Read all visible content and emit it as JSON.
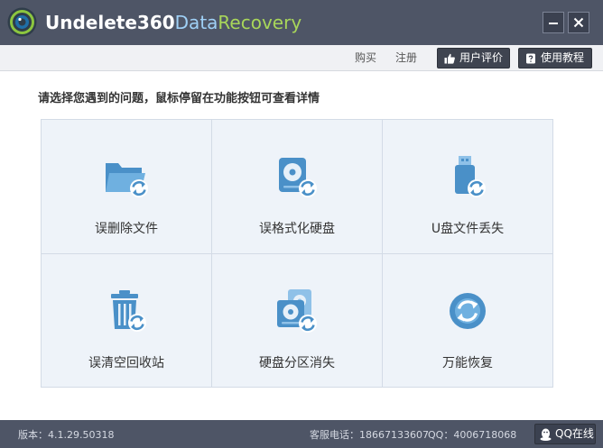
{
  "app": {
    "name_part1": "Undelete360",
    "name_part2": "Data",
    "name_part3": "Recovery"
  },
  "window_controls": {
    "minimize": "—",
    "close": "✕"
  },
  "subbar": {
    "buy": "购买",
    "register": "注册",
    "review_button": "用户评价",
    "guide_button": "使用教程"
  },
  "main": {
    "prompt": "请选择您遇到的问题，鼠标停留在功能按钮可查看详情",
    "tiles": [
      {
        "label": "误删除文件",
        "icon": "folder-recovery-icon"
      },
      {
        "label": "误格式化硬盘",
        "icon": "disk-format-icon"
      },
      {
        "label": "U盘文件丢失",
        "icon": "usb-drive-icon"
      },
      {
        "label": "误清空回收站",
        "icon": "recycle-bin-icon"
      },
      {
        "label": "硬盘分区消失",
        "icon": "disk-partition-icon"
      },
      {
        "label": "万能恢复",
        "icon": "universal-recovery-icon"
      }
    ]
  },
  "statusbar": {
    "version": "版本：4.1.29.50318",
    "service_phone": "客服电话：18667133607",
    "qq": "QQ：4006718068",
    "qq_online": "QQ在线"
  },
  "colors": {
    "titlebar": "#4e5566",
    "accent_blue": "#4a90c8",
    "tile_bg": "#eef3f9",
    "logo_green": "#8cc63f"
  }
}
